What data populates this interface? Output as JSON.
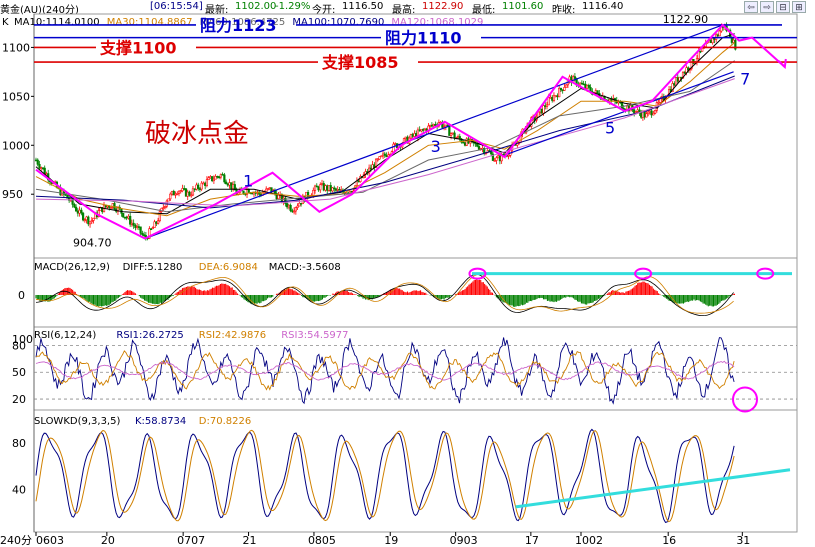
{
  "header": {
    "instrument": "黄金(AU)(240分)",
    "time": "[06:15:54]",
    "latest_label": "最新:",
    "latest": "1102.00",
    "change": "-1.29%",
    "open_label": "今开:",
    "open": "1116.50",
    "high_label": "最高:",
    "high": "1122.90",
    "low_label": "最低:",
    "low": "1101.60",
    "prev_close_label": "昨收:",
    "prev_close": "1116.40"
  },
  "nav_buttons": [
    "⇦",
    "⇨",
    "⊟",
    "⊞"
  ],
  "colors": {
    "ma10": "#000000",
    "ma30": "#d08000",
    "ma60": "#6a6a6a",
    "ma100": "#000080",
    "ma120": "#cc66cc",
    "up": "#ff0000",
    "down": "#008000",
    "resistance": "#0000cc",
    "support": "#dd0000",
    "magenta": "#ff00ff",
    "cyan": "#33dddd",
    "annotation": "#0000cc",
    "title_red": "#cc0000"
  },
  "chart_data": [
    {
      "type": "line",
      "subtype": "candlestick",
      "title": "破冰点金",
      "indicator_label": "K",
      "legend": [
        {
          "name": "MA10",
          "value": "1114.0100",
          "color": "#000000"
        },
        {
          "name": "MA30",
          "value": "1104.8867",
          "color": "#d08000"
        },
        {
          "name": "MA60",
          "value": "1086.4725",
          "color": "#6a6a6a"
        },
        {
          "name": "MA100",
          "value": "1070.7690",
          "color": "#000080"
        },
        {
          "name": "MA120",
          "value": "1068.1029",
          "color": "#cc66cc"
        }
      ],
      "ylim": [
        893,
        1128
      ],
      "yticks": [
        950,
        1000,
        1050,
        1100
      ],
      "price_path": [
        [
          0,
          985
        ],
        [
          10,
          970
        ],
        [
          20,
          955
        ],
        [
          30,
          945
        ],
        [
          40,
          930
        ],
        [
          50,
          922
        ],
        [
          60,
          935
        ],
        [
          70,
          940
        ],
        [
          80,
          930
        ],
        [
          90,
          918
        ],
        [
          95,
          912
        ],
        [
          100,
          904.7
        ],
        [
          110,
          920
        ],
        [
          120,
          945
        ],
        [
          130,
          955
        ],
        [
          140,
          950
        ],
        [
          150,
          958
        ],
        [
          160,
          965
        ],
        [
          170,
          970
        ],
        [
          178,
          960
        ],
        [
          185,
          950
        ],
        [
          195,
          955
        ],
        [
          205,
          950
        ],
        [
          215,
          955
        ],
        [
          225,
          945
        ],
        [
          235,
          935
        ],
        [
          240,
          940
        ],
        [
          250,
          950
        ],
        [
          260,
          958
        ],
        [
          270,
          955
        ],
        [
          280,
          952
        ],
        [
          290,
          955
        ],
        [
          300,
          968
        ],
        [
          310,
          980
        ],
        [
          320,
          990
        ],
        [
          330,
          1000
        ],
        [
          340,
          1005
        ],
        [
          350,
          1012
        ],
        [
          360,
          1018
        ],
        [
          370,
          1024
        ],
        [
          378,
          1015
        ],
        [
          385,
          1008
        ],
        [
          395,
          1003
        ],
        [
          405,
          1000
        ],
        [
          415,
          993
        ],
        [
          422,
          985
        ],
        [
          430,
          990
        ],
        [
          440,
          1000
        ],
        [
          450,
          1020
        ],
        [
          460,
          1030
        ],
        [
          470,
          1045
        ],
        [
          480,
          1055
        ],
        [
          490,
          1068
        ],
        [
          500,
          1062
        ],
        [
          510,
          1055
        ],
        [
          520,
          1050
        ],
        [
          530,
          1045
        ],
        [
          540,
          1040
        ],
        [
          550,
          1035
        ],
        [
          560,
          1030
        ],
        [
          570,
          1040
        ],
        [
          580,
          1055
        ],
        [
          590,
          1070
        ],
        [
          600,
          1082
        ],
        [
          610,
          1095
        ],
        [
          620,
          1108
        ],
        [
          625,
          1112
        ],
        [
          630,
          1122.9
        ],
        [
          636,
          1115
        ],
        [
          641,
          1102
        ]
      ],
      "ma_lines": [
        {
          "name": "MA10",
          "points": [
            [
              0,
              978
            ],
            [
              40,
              940
            ],
            [
              80,
              932
            ],
            [
              120,
              930
            ],
            [
              160,
              955
            ],
            [
              200,
              955
            ],
            [
              240,
              945
            ],
            [
              280,
              952
            ],
            [
              320,
              985
            ],
            [
              360,
              1012
            ],
            [
              400,
              1004
            ],
            [
              430,
              992
            ],
            [
              460,
              1028
            ],
            [
              500,
              1058
            ],
            [
              540,
              1043
            ],
            [
              570,
              1038
            ],
            [
              600,
              1078
            ],
            [
              630,
              1110
            ],
            [
              641,
              1114
            ]
          ]
        },
        {
          "name": "MA30",
          "points": [
            [
              0,
              968
            ],
            [
              40,
              945
            ],
            [
              80,
              935
            ],
            [
              120,
              928
            ],
            [
              160,
              945
            ],
            [
              200,
              952
            ],
            [
              240,
              948
            ],
            [
              280,
              950
            ],
            [
              320,
              972
            ],
            [
              360,
              1000
            ],
            [
              400,
              1005
            ],
            [
              430,
              996
            ],
            [
              460,
              1015
            ],
            [
              500,
              1045
            ],
            [
              540,
              1045
            ],
            [
              570,
              1040
            ],
            [
              600,
              1065
            ],
            [
              630,
              1095
            ],
            [
              641,
              1104.9
            ]
          ]
        },
        {
          "name": "MA60",
          "points": [
            [
              0,
              955
            ],
            [
              60,
              945
            ],
            [
              120,
              932
            ],
            [
              180,
              940
            ],
            [
              240,
              946
            ],
            [
              300,
              952
            ],
            [
              360,
              985
            ],
            [
              420,
              998
            ],
            [
              480,
              1030
            ],
            [
              540,
              1040
            ],
            [
              600,
              1055
            ],
            [
              641,
              1086.5
            ]
          ]
        },
        {
          "name": "MA100",
          "points": [
            [
              0,
              948
            ],
            [
              80,
              944
            ],
            [
              160,
              936
            ],
            [
              240,
              944
            ],
            [
              320,
              962
            ],
            [
              400,
              988
            ],
            [
              480,
              1015
            ],
            [
              560,
              1035
            ],
            [
              641,
              1070.8
            ]
          ]
        },
        {
          "name": "MA120",
          "points": [
            [
              0,
              945
            ],
            [
              90,
              943
            ],
            [
              180,
              938
            ],
            [
              270,
              945
            ],
            [
              360,
              970
            ],
            [
              450,
              1000
            ],
            [
              540,
              1028
            ],
            [
              641,
              1068.1
            ]
          ]
        }
      ],
      "wave_pattern": [
        [
          0,
          975
        ],
        [
          55,
          930
        ],
        [
          100,
          904.7
        ],
        [
          165,
          940
        ],
        [
          217,
          972
        ],
        [
          260,
          932
        ],
        [
          290,
          950
        ],
        [
          335,
          1000
        ],
        [
          375,
          1024
        ],
        [
          430,
          988
        ],
        [
          483,
          1070
        ],
        [
          540,
          1035
        ],
        [
          565,
          1045
        ],
        [
          598,
          1085
        ],
        [
          630,
          1122.9
        ],
        [
          645,
          1107
        ],
        [
          657,
          1110
        ],
        [
          687,
          1080
        ]
      ],
      "trend_lines": [
        [
          [
            100,
            904.7
          ],
          [
            630,
            1122.9
          ]
        ],
        [
          [
            430,
            990
          ],
          [
            640,
            1075
          ]
        ]
      ],
      "reference_lines": [
        {
          "label": "阻力1123",
          "value": 1123,
          "color": "#0000cc"
        },
        {
          "label": "阻力1110",
          "value": 1110,
          "color": "#0000cc"
        },
        {
          "label": "支撑1100",
          "value": 1100,
          "color": "#dd0000"
        },
        {
          "label": "支撑1085",
          "value": 1085,
          "color": "#dd0000"
        }
      ],
      "annotations": [
        {
          "text": "904.70",
          "x": 100,
          "y": 904.7
        },
        {
          "text": "1122.90",
          "x": 630,
          "y": 1122.9
        }
      ],
      "wave_labels": [
        {
          "text": "1",
          "x": 190,
          "y": 958
        },
        {
          "text": "3",
          "x": 362,
          "y": 993
        },
        {
          "text": "5",
          "x": 522,
          "y": 1012
        },
        {
          "text": "7",
          "x": 646,
          "y": 1062
        }
      ]
    },
    {
      "type": "bar",
      "indicator_label": "MACD(26,12,9)",
      "legend": [
        {
          "name": "DIFF",
          "value": "5.1280",
          "color": "#000000"
        },
        {
          "name": "DEA",
          "value": "6.9084",
          "color": "#d08000"
        },
        {
          "name": "MACD",
          "value": "-3.5608",
          "color": "#000000"
        }
      ],
      "ylim": [
        -12,
        12
      ],
      "yticks": [
        0
      ],
      "peaks": [
        [
          405,
          9.5
        ],
        [
          557,
          9.5
        ],
        [
          669,
          9.5
        ]
      ],
      "histogram_waves": [
        {
          "peak": 10,
          "amp": -3,
          "width": 20
        },
        {
          "peak": 28,
          "amp": 4,
          "width": 14
        },
        {
          "peak": 60,
          "amp": -5,
          "width": 25
        },
        {
          "peak": 85,
          "amp": 3,
          "width": 12
        },
        {
          "peak": 110,
          "amp": -4,
          "width": 22
        },
        {
          "peak": 140,
          "amp": 4,
          "width": 18
        },
        {
          "peak": 172,
          "amp": 5,
          "width": 20
        },
        {
          "peak": 200,
          "amp": -4,
          "width": 20
        },
        {
          "peak": 232,
          "amp": 3,
          "width": 14
        },
        {
          "peak": 255,
          "amp": -3,
          "width": 16
        },
        {
          "peak": 282,
          "amp": 2,
          "width": 14
        },
        {
          "peak": 305,
          "amp": -2,
          "width": 14
        },
        {
          "peak": 330,
          "amp": 3,
          "width": 14
        },
        {
          "peak": 350,
          "amp": 2,
          "width": 12
        },
        {
          "peak": 372,
          "amp": -2,
          "width": 12
        },
        {
          "peak": 405,
          "amp": 7,
          "width": 18
        },
        {
          "peak": 440,
          "amp": -5,
          "width": 26
        },
        {
          "peak": 475,
          "amp": -3,
          "width": 14
        },
        {
          "peak": 505,
          "amp": -4,
          "width": 18
        },
        {
          "peak": 530,
          "amp": 2,
          "width": 10
        },
        {
          "peak": 557,
          "amp": 6,
          "width": 18
        },
        {
          "peak": 590,
          "amp": -4,
          "width": 20
        },
        {
          "peak": 620,
          "amp": -5,
          "width": 18
        },
        {
          "peak": 645,
          "amp": 2,
          "width": 8
        },
        {
          "peak": 669,
          "amp": 6,
          "width": 16
        },
        {
          "peak": 695,
          "amp": 3,
          "width": 10
        },
        {
          "peak": 703,
          "amp": -2,
          "width": 4
        }
      ]
    },
    {
      "type": "line",
      "indicator_label": "RSI(6,12,24)",
      "legend": [
        {
          "name": "RSI1",
          "value": "26.2725",
          "color": "#000080"
        },
        {
          "name": "RSI2",
          "value": "42.9876",
          "color": "#d08000"
        },
        {
          "name": "RSI3",
          "value": "54.5977",
          "color": "#cc66cc"
        }
      ],
      "ylim": [
        10,
        95
      ],
      "yticks": [
        20,
        50,
        80,
        100
      ],
      "gridlines": [
        20,
        50,
        80
      ]
    },
    {
      "type": "line",
      "indicator_label": "SLOWKD(9,3,3,5)",
      "legend": [
        {
          "name": "K",
          "value": "58.8734",
          "color": "#000080"
        },
        {
          "name": "D",
          "value": "70.8226",
          "color": "#d08000"
        }
      ],
      "ylim": [
        5,
        100
      ],
      "yticks": [
        40,
        80
      ],
      "trend_line": [
        [
          440,
          25
        ],
        [
          755,
          57
        ]
      ]
    }
  ],
  "x_axis": {
    "period_label": "240分",
    "ticks": [
      {
        "label": "0603",
        "x": 0
      },
      {
        "label": "20",
        "x": 65
      },
      {
        "label": "0707",
        "x": 135
      },
      {
        "label": "21",
        "x": 195
      },
      {
        "label": "0805",
        "x": 255
      },
      {
        "label": "19",
        "x": 325
      },
      {
        "label": "0903",
        "x": 385
      },
      {
        "label": "17",
        "x": 454
      },
      {
        "label": "1002",
        "x": 500
      },
      {
        "label": "16",
        "x": 580
      },
      {
        "label": "31",
        "x": 648
      }
    ]
  }
}
